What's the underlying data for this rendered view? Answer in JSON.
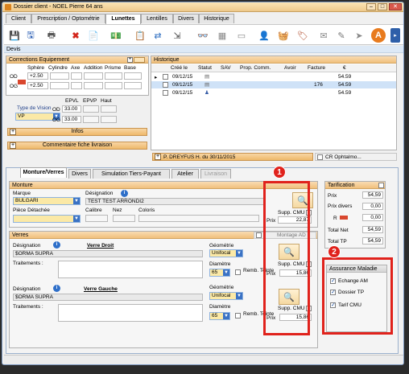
{
  "window": {
    "title": "Dossier client - NOEL Pierre 64 ans"
  },
  "tabs": [
    {
      "label": "Client"
    },
    {
      "label": "Prescription / Optométrie"
    },
    {
      "label": "Lunettes"
    },
    {
      "label": "Lentilles"
    },
    {
      "label": "Divers"
    },
    {
      "label": "Historique"
    }
  ],
  "section": {
    "devis": "Devis"
  },
  "corrections": {
    "title": "Corrections Equipement",
    "headers": [
      "Sphère",
      "Cylindre",
      "Axe",
      "Addition",
      "Prisme",
      "Base"
    ],
    "od_label": "OD",
    "og_label": "OG",
    "od_sphere": "+2.50",
    "og_sphere": "+2.50",
    "ev_headers": [
      "EPVL",
      "EPVP",
      "Haut"
    ],
    "type_vision_label": "Type de Vision",
    "type_vision_value": "VP",
    "od_epvl": "33.00",
    "og_epvl": "33.00",
    "infos_label": "Infos",
    "commentaire_label": "Commentaire fiche livraison"
  },
  "historique": {
    "title": "Historique",
    "headers": [
      "Créé le",
      "Statut",
      "SAV",
      "Prop. Comm.",
      "Avoir",
      "Facture",
      "€"
    ],
    "rows": [
      {
        "date": "09/12/15",
        "facture": "",
        "amount": "54.59"
      },
      {
        "date": "09/12/15",
        "facture": "176",
        "amount": "54.59"
      },
      {
        "date": "09/12/15",
        "facture": "",
        "amount": "54.59"
      }
    ],
    "prescriber": "P. DREYFUS H. du 30/11/2015",
    "cr_label": "CR Ophtalmo..."
  },
  "subtabs": [
    {
      "label": "Monture/Verres"
    },
    {
      "label": "Divers"
    },
    {
      "label": "Simulation Tiers-Payant"
    },
    {
      "label": "Atelier"
    },
    {
      "label": "Livraison"
    }
  ],
  "monture": {
    "title": "Monture",
    "marque_label": "Marque",
    "marque_value": "BULGARI",
    "designation_label": "Désignation",
    "designation_value": "TEST TEST ARRONDI2",
    "piece_label": "Pièce Détachée",
    "calibre_label": "Calibre",
    "nez_label": "Nez",
    "coloris_label": "Coloris",
    "supp_cmu": "Supp. CMU",
    "prix_label": "Prix",
    "prix_value": "22,87"
  },
  "verres": {
    "title": "Verres",
    "montage_ad": "Montage AD",
    "droit_title": "Verre Droit",
    "gauche_title": "Verre Gauche",
    "designation_label": "Désignation",
    "traitements_label": "Traitements :",
    "droit_designation": "$ORMA SUPRA",
    "gauche_designation": "$ORMA SUPRA",
    "geometrie_label": "Géométrie",
    "geometrie_value": "Unifocal",
    "diametre_label": "Diamètre",
    "diametre_value": "65",
    "remb_teinte": "Remb. Teinte",
    "supp_cmu": "Supp. CMU",
    "prix_label": "Prix",
    "droit_prix": "15,86",
    "gauche_prix": "15,86"
  },
  "tarification": {
    "title": "Tarification",
    "prix_label": "Prix",
    "prix_value": "54,59",
    "prix_divers_label": "Prix divers",
    "prix_divers_value": "0,00",
    "r_label": "R",
    "r_value": "0,00",
    "total_net_label": "Total Net",
    "total_net_value": "54,59",
    "total_tp_label": "Total TP",
    "total_tp_value": "54,59"
  },
  "assurance": {
    "title": "Assurance Maladie",
    "items": [
      {
        "label": "Echange AM"
      },
      {
        "label": "Dossier TP"
      },
      {
        "label": "Tarif CMU"
      }
    ]
  },
  "annotations": {
    "badge1": "1",
    "badge2": "2",
    "accent": "#e0221c"
  }
}
